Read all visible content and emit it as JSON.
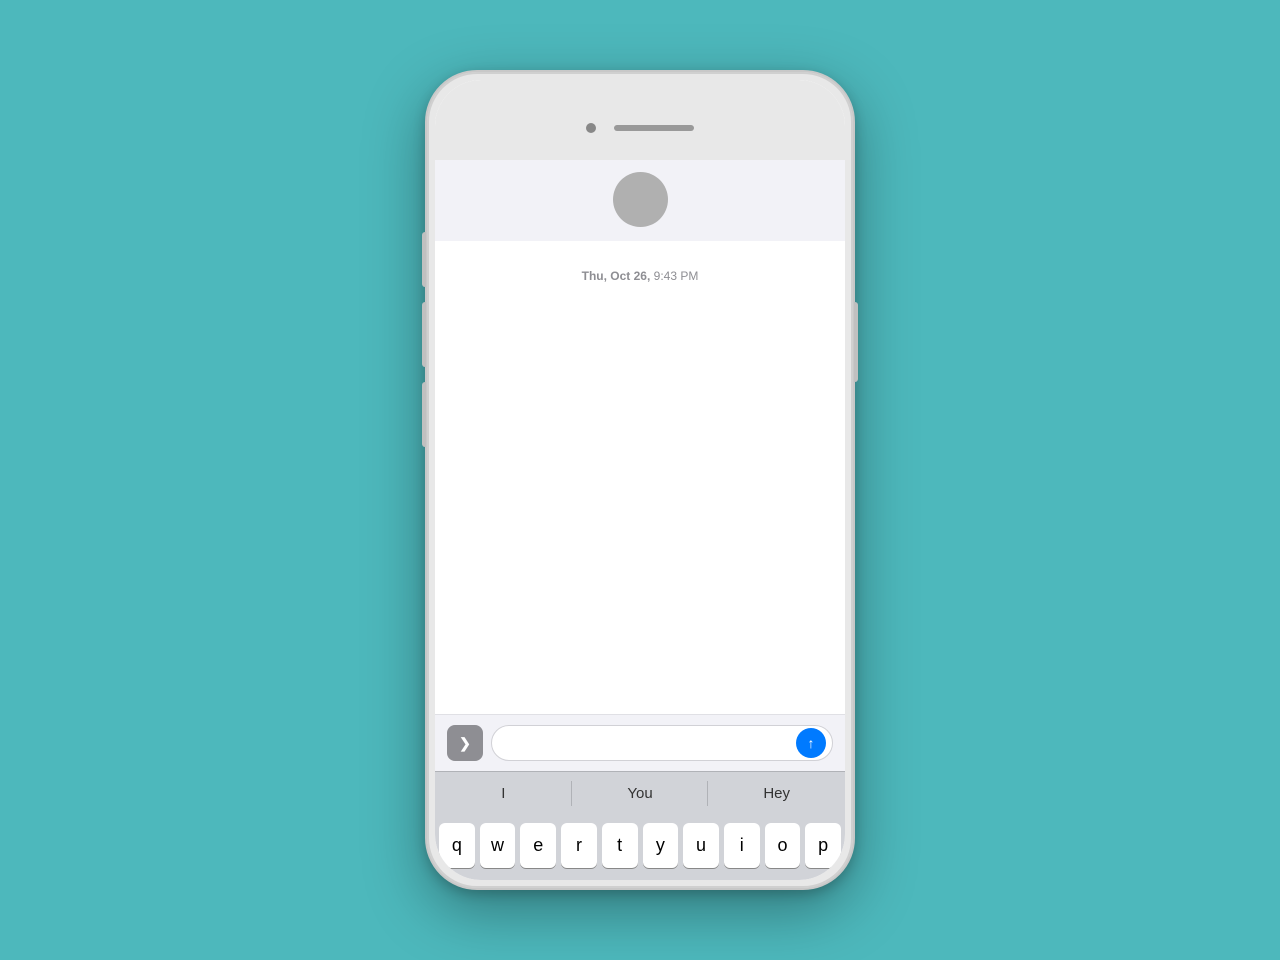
{
  "background_color": "#4db8bc",
  "phone": {
    "screen": {
      "contact": {
        "avatar_label": "contact-avatar"
      },
      "timestamp": {
        "day": "Thu, Oct 26,",
        "time": "9:43 PM"
      },
      "input_bar": {
        "expand_icon": "❯",
        "placeholder": "",
        "send_icon": "↑"
      },
      "predictive": {
        "words": [
          "I",
          "You",
          "Hey"
        ]
      },
      "keyboard_rows": [
        [
          "q",
          "w",
          "e",
          "r",
          "t",
          "y",
          "u",
          "i",
          "o",
          "p"
        ]
      ]
    }
  }
}
